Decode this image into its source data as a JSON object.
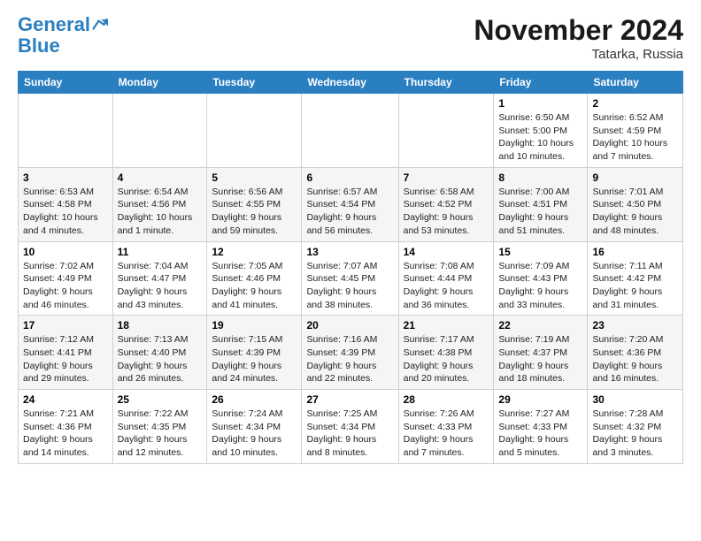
{
  "logo": {
    "line1": "General",
    "line2": "Blue"
  },
  "title": "November 2024",
  "location": "Tatarka, Russia",
  "days_header": [
    "Sunday",
    "Monday",
    "Tuesday",
    "Wednesday",
    "Thursday",
    "Friday",
    "Saturday"
  ],
  "weeks": [
    [
      {
        "day": "",
        "info": ""
      },
      {
        "day": "",
        "info": ""
      },
      {
        "day": "",
        "info": ""
      },
      {
        "day": "",
        "info": ""
      },
      {
        "day": "",
        "info": ""
      },
      {
        "day": "1",
        "info": "Sunrise: 6:50 AM\nSunset: 5:00 PM\nDaylight: 10 hours and 10 minutes."
      },
      {
        "day": "2",
        "info": "Sunrise: 6:52 AM\nSunset: 4:59 PM\nDaylight: 10 hours and 7 minutes."
      }
    ],
    [
      {
        "day": "3",
        "info": "Sunrise: 6:53 AM\nSunset: 4:58 PM\nDaylight: 10 hours and 4 minutes."
      },
      {
        "day": "4",
        "info": "Sunrise: 6:54 AM\nSunset: 4:56 PM\nDaylight: 10 hours and 1 minute."
      },
      {
        "day": "5",
        "info": "Sunrise: 6:56 AM\nSunset: 4:55 PM\nDaylight: 9 hours and 59 minutes."
      },
      {
        "day": "6",
        "info": "Sunrise: 6:57 AM\nSunset: 4:54 PM\nDaylight: 9 hours and 56 minutes."
      },
      {
        "day": "7",
        "info": "Sunrise: 6:58 AM\nSunset: 4:52 PM\nDaylight: 9 hours and 53 minutes."
      },
      {
        "day": "8",
        "info": "Sunrise: 7:00 AM\nSunset: 4:51 PM\nDaylight: 9 hours and 51 minutes."
      },
      {
        "day": "9",
        "info": "Sunrise: 7:01 AM\nSunset: 4:50 PM\nDaylight: 9 hours and 48 minutes."
      }
    ],
    [
      {
        "day": "10",
        "info": "Sunrise: 7:02 AM\nSunset: 4:49 PM\nDaylight: 9 hours and 46 minutes."
      },
      {
        "day": "11",
        "info": "Sunrise: 7:04 AM\nSunset: 4:47 PM\nDaylight: 9 hours and 43 minutes."
      },
      {
        "day": "12",
        "info": "Sunrise: 7:05 AM\nSunset: 4:46 PM\nDaylight: 9 hours and 41 minutes."
      },
      {
        "day": "13",
        "info": "Sunrise: 7:07 AM\nSunset: 4:45 PM\nDaylight: 9 hours and 38 minutes."
      },
      {
        "day": "14",
        "info": "Sunrise: 7:08 AM\nSunset: 4:44 PM\nDaylight: 9 hours and 36 minutes."
      },
      {
        "day": "15",
        "info": "Sunrise: 7:09 AM\nSunset: 4:43 PM\nDaylight: 9 hours and 33 minutes."
      },
      {
        "day": "16",
        "info": "Sunrise: 7:11 AM\nSunset: 4:42 PM\nDaylight: 9 hours and 31 minutes."
      }
    ],
    [
      {
        "day": "17",
        "info": "Sunrise: 7:12 AM\nSunset: 4:41 PM\nDaylight: 9 hours and 29 minutes."
      },
      {
        "day": "18",
        "info": "Sunrise: 7:13 AM\nSunset: 4:40 PM\nDaylight: 9 hours and 26 minutes."
      },
      {
        "day": "19",
        "info": "Sunrise: 7:15 AM\nSunset: 4:39 PM\nDaylight: 9 hours and 24 minutes."
      },
      {
        "day": "20",
        "info": "Sunrise: 7:16 AM\nSunset: 4:39 PM\nDaylight: 9 hours and 22 minutes."
      },
      {
        "day": "21",
        "info": "Sunrise: 7:17 AM\nSunset: 4:38 PM\nDaylight: 9 hours and 20 minutes."
      },
      {
        "day": "22",
        "info": "Sunrise: 7:19 AM\nSunset: 4:37 PM\nDaylight: 9 hours and 18 minutes."
      },
      {
        "day": "23",
        "info": "Sunrise: 7:20 AM\nSunset: 4:36 PM\nDaylight: 9 hours and 16 minutes."
      }
    ],
    [
      {
        "day": "24",
        "info": "Sunrise: 7:21 AM\nSunset: 4:36 PM\nDaylight: 9 hours and 14 minutes."
      },
      {
        "day": "25",
        "info": "Sunrise: 7:22 AM\nSunset: 4:35 PM\nDaylight: 9 hours and 12 minutes."
      },
      {
        "day": "26",
        "info": "Sunrise: 7:24 AM\nSunset: 4:34 PM\nDaylight: 9 hours and 10 minutes."
      },
      {
        "day": "27",
        "info": "Sunrise: 7:25 AM\nSunset: 4:34 PM\nDaylight: 9 hours and 8 minutes."
      },
      {
        "day": "28",
        "info": "Sunrise: 7:26 AM\nSunset: 4:33 PM\nDaylight: 9 hours and 7 minutes."
      },
      {
        "day": "29",
        "info": "Sunrise: 7:27 AM\nSunset: 4:33 PM\nDaylight: 9 hours and 5 minutes."
      },
      {
        "day": "30",
        "info": "Sunrise: 7:28 AM\nSunset: 4:32 PM\nDaylight: 9 hours and 3 minutes."
      }
    ]
  ]
}
